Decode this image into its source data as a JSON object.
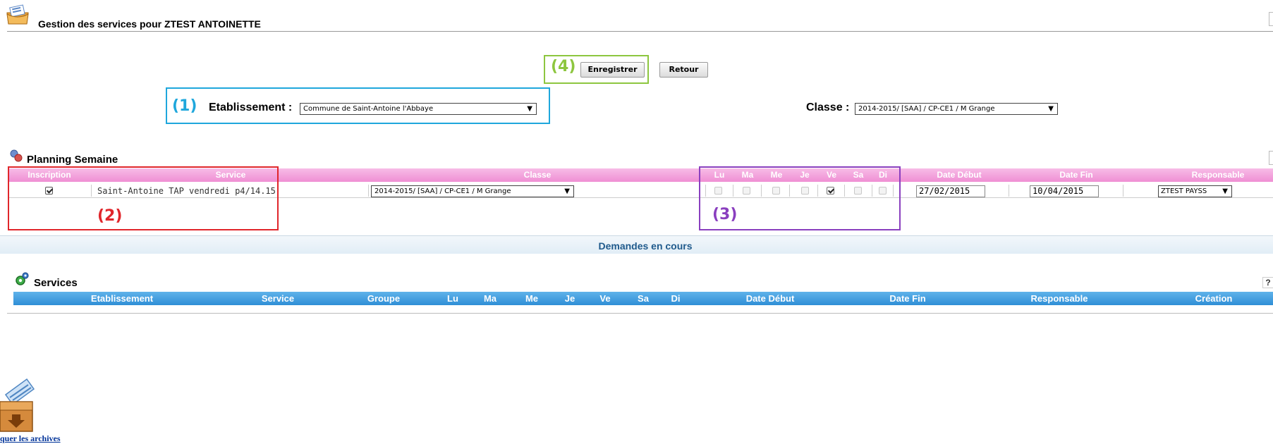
{
  "header": {
    "title": "Gestion des services pour ZTEST ANTOINETTE"
  },
  "toolbar": {
    "save_label": "Enregistrer",
    "back_label": "Retour"
  },
  "annotations": {
    "n1": "(1)",
    "n2": "(2)",
    "n3": "(3)",
    "n4": "(4)",
    "colors": {
      "n1": "#1fa7dc",
      "n2": "#e0262b",
      "n3": "#8a3fbf",
      "n4": "#8dc63f"
    }
  },
  "filters": {
    "etablissement_label": "Etablissement :",
    "etablissement_value": "Commune de Saint-Antoine l'Abbaye",
    "classe_label": "Classe :",
    "classe_value": "2014-2015/ [SAA] / CP-CE1 / M Grange"
  },
  "planning": {
    "title": "Planning Semaine",
    "columns": [
      "Inscription",
      "Service",
      "Classe",
      "Lu",
      "Ma",
      "Me",
      "Je",
      "Ve",
      "Sa",
      "Di",
      "Date Début",
      "Date Fin",
      "Responsable"
    ],
    "row": {
      "inscription_checked": true,
      "service": "Saint-Antoine TAP vendredi p4/14.15",
      "classe": "2014-2015/ [SAA] / CP-CE1 / M Grange",
      "days": {
        "Lu": false,
        "Ma": false,
        "Me": false,
        "Je": false,
        "Ve": true,
        "Sa": false,
        "Di": false
      },
      "date_debut": "27/02/2015",
      "date_fin": "10/04/2015",
      "responsable": "ZTEST PAYSS"
    },
    "header_color": "#ef8fd4"
  },
  "demandes": {
    "title": "Demandes en cours"
  },
  "services": {
    "title": "Services",
    "help": "?",
    "columns": [
      "Etablissement",
      "Service",
      "Groupe",
      "Lu",
      "Ma",
      "Me",
      "Je",
      "Ve",
      "Sa",
      "Di",
      "Date Début",
      "Date Fin",
      "Responsable",
      "Création"
    ],
    "header_color": "#2f8ed6"
  },
  "archives": {
    "link_label": "quer les archives"
  },
  "icons": [
    "services-folder-icon",
    "planning-icon",
    "services-gear-icon",
    "archive-box-icon",
    "help-icon"
  ]
}
